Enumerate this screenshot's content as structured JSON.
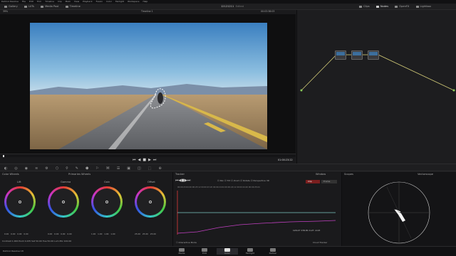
{
  "app": {
    "menus": [
      "DaVinci Resolve",
      "File",
      "Edit",
      "Trim",
      "Timeline",
      "Clip",
      "Mark",
      "View",
      "Playback",
      "Fusion",
      "Color",
      "Fairlight",
      "Workspace",
      "Help"
    ]
  },
  "toolbar": {
    "left": [
      "Gallery",
      "LUTs",
      "Media Pool",
      "Timeline"
    ],
    "title": "12121211",
    "title_status": "Edited",
    "right": [
      "Clips",
      "Nodes",
      "OpenFX",
      "Lightbox"
    ],
    "zoom": "39%",
    "timeline_name": "Timeline 1",
    "clip_mode": "Clip"
  },
  "viewer": {
    "timecode_top": "00:03:38:03",
    "timecode": "01:00:23:22"
  },
  "wheels": {
    "title": "Color Wheels",
    "mode": "Primaries Wheels",
    "items": [
      {
        "name": "Lift",
        "vals": [
          "0.00",
          "0.00",
          "0.00",
          "0.00"
        ]
      },
      {
        "name": "Gamma",
        "vals": [
          "0.00",
          "0.00",
          "0.00",
          "0.00"
        ]
      },
      {
        "name": "Gain",
        "vals": [
          "1.00",
          "1.00",
          "1.00",
          "1.00"
        ]
      },
      {
        "name": "Offset",
        "vals": [
          "25.00",
          "25.00",
          "25.00",
          ""
        ]
      }
    ],
    "footer": [
      {
        "label": "Contrast",
        "value": "1.000"
      },
      {
        "label": "Pivot",
        "value": "0.435"
      },
      {
        "label": "Sat",
        "value": "50.00"
      },
      {
        "label": "Hue",
        "value": "50.00"
      },
      {
        "label": "Lum Mix",
        "value": "100.00"
      }
    ]
  },
  "tracker": {
    "title": "Tracker",
    "mode": "Window",
    "checks": [
      "Pan",
      "Tilt",
      "Zoom",
      "Rotate",
      "Perspective 3D"
    ],
    "buttons": [
      "Clip",
      "Frame"
    ],
    "ruler": [
      "00:00:23:04",
      "00:00:23:12",
      "00:00:23:20",
      "00:00:24:04",
      "00:00:24:12",
      "00:00:24:20",
      "00:00:25:04"
    ],
    "values": [
      "129.27",
      "176.81",
      "0.27",
      "-0.23"
    ],
    "footer_check": "Interactive Mode",
    "footer_select": "Cloud Tracker"
  },
  "scope": {
    "title": "Scopes",
    "type": "Vectorscope"
  },
  "bottombar": {
    "app_name": "DaVinci Resolve 18",
    "pages": [
      "Media",
      "Edit",
      "Color",
      "Fairlight",
      "Deliver"
    ],
    "active": "Color"
  }
}
